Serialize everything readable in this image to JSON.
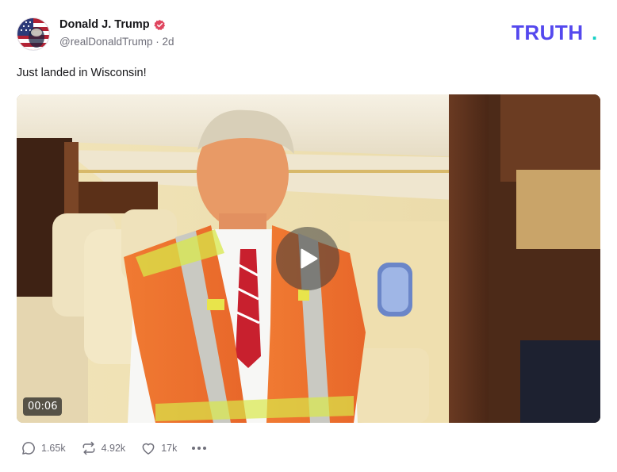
{
  "post": {
    "author": {
      "display_name": "Donald J. Trump",
      "handle": "@realDonaldTrump",
      "time_ago": "2d",
      "separator": "·",
      "verified": true,
      "avatar_icon": "flag-portrait-avatar"
    },
    "text": "Just landed in Wisconsin!",
    "media": {
      "type": "video",
      "duration": "00:06",
      "play_icon": "play-icon"
    },
    "stats": {
      "replies": "1.65k",
      "reposts": "4.92k",
      "likes": "17k"
    }
  },
  "brand": {
    "logo_text": "TRUTH",
    "logo_dot": ".",
    "color_primary": "#5448ee",
    "color_dot": "#15d0c5"
  },
  "colors": {
    "verified_badge": "#e0465f",
    "secondary_text": "#6f6f7a"
  }
}
